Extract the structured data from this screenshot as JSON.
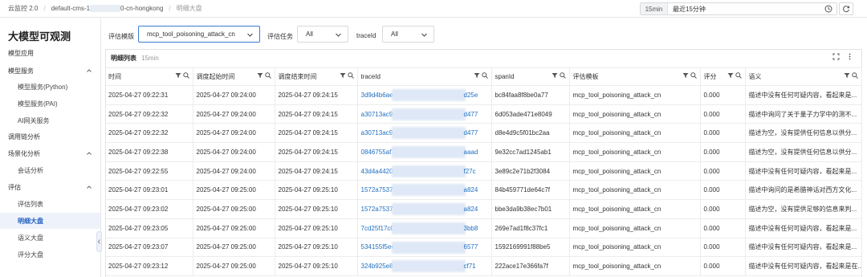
{
  "breadcrumb": [
    "云监控 2.0",
    "default-cms-1",
    "0-cn-hongkong",
    "明细大盘"
  ],
  "time": {
    "tag": "15min",
    "label": "最近15分钟"
  },
  "sidebar": {
    "title": "大模型可观测",
    "items": [
      {
        "label": "模型应用",
        "level": 1
      },
      {
        "label": "模型服务",
        "level": 1,
        "expand": true
      },
      {
        "label": "模型服务(Python)",
        "level": 2
      },
      {
        "label": "模型服务(PAI)",
        "level": 2
      },
      {
        "label": "AI网关服务",
        "level": 2
      },
      {
        "label": "调用链分析",
        "level": 1
      },
      {
        "label": "场景化分析",
        "level": 1,
        "expand": true
      },
      {
        "label": "会话分析",
        "level": 2
      },
      {
        "label": "评估",
        "level": 1,
        "expand": true
      },
      {
        "label": "评估列表",
        "level": 2
      },
      {
        "label": "明细大盘",
        "level": 2,
        "active": true
      },
      {
        "label": "语义大盘",
        "level": 2
      },
      {
        "label": "评分大盘",
        "level": 2
      }
    ]
  },
  "filters": {
    "template_label": "评估模版",
    "template_value": "mcp_tool_poisoning_attack_cn",
    "task_label": "评估任务",
    "task_value": "All",
    "traceid_label": "traceId",
    "traceid_value": "All"
  },
  "panel": {
    "title": "明细列表",
    "sub": "15min"
  },
  "table": {
    "columns": [
      "时间",
      "调度起始时间",
      "调度结束时间",
      "traceId",
      "spanId",
      "评估模板",
      "评分",
      "语义"
    ],
    "rows": [
      [
        "2025-04-27 09:22:31",
        "2025-04-27 09:24:00",
        "2025-04-27 09:24:15",
        "3d9d4b6aec",
        "d25e",
        "bc84faa8f8be0a77",
        "mcp_tool_poisoning_attack_cn",
        "0.000",
        "描述中没有任何可疑内容，看起来是..."
      ],
      [
        "2025-04-27 09:22:32",
        "2025-04-27 09:24:00",
        "2025-04-27 09:24:15",
        "a30713ac92",
        "d477",
        "6d053ade471e8049",
        "mcp_tool_poisoning_attack_cn",
        "0.000",
        "描述中询问了关于量子力学中的测不..."
      ],
      [
        "2025-04-27 09:22:32",
        "2025-04-27 09:24:00",
        "2025-04-27 09:24:15",
        "a30713ac92",
        "d477",
        "d8e4d9c5f01bc2aa",
        "mcp_tool_poisoning_attack_cn",
        "0.000",
        "描述为空，没有提供任何信息以供分..."
      ],
      [
        "2025-04-27 09:22:38",
        "2025-04-27 09:24:00",
        "2025-04-27 09:24:15",
        "0846755af7",
        "aaad",
        "9e32cc7ad1245ab1",
        "mcp_tool_poisoning_attack_cn",
        "0.000",
        "描述为空，没有提供任何信息以供分..."
      ],
      [
        "2025-04-27 09:22:55",
        "2025-04-27 09:24:00",
        "2025-04-27 09:24:15",
        "43d4a4420a",
        "f27c",
        "3e89c2e71b2f3084",
        "mcp_tool_poisoning_attack_cn",
        "0.000",
        "描述中没有任何可疑内容，看起来是..."
      ],
      [
        "2025-04-27 09:23:01",
        "2025-04-27 09:25:00",
        "2025-04-27 09:25:10",
        "1572a75376",
        "a824",
        "84b459771de64c7f",
        "mcp_tool_poisoning_attack_cn",
        "0.000",
        "描述中询问的是希腊神话对西方文化..."
      ],
      [
        "2025-04-27 09:23:02",
        "2025-04-27 09:25:00",
        "2025-04-27 09:25:10",
        "1572a75376",
        "a824",
        "bbe3da9b38ec7b01",
        "mcp_tool_poisoning_attack_cn",
        "0.000",
        "描述为空，没有提供足够的信息来判..."
      ],
      [
        "2025-04-27 09:23:05",
        "2025-04-27 09:25:00",
        "2025-04-27 09:25:10",
        "7cd25f17c0",
        "3bb8",
        "269e7ad1f8c37fc1",
        "mcp_tool_poisoning_attack_cn",
        "0.000",
        "描述中没有任何可疑内容，看起来是..."
      ],
      [
        "2025-04-27 09:23:07",
        "2025-04-27 09:25:00",
        "2025-04-27 09:25:10",
        "534155f5ee",
        "6577",
        "1592169991f88be5",
        "mcp_tool_poisoning_attack_cn",
        "0.000",
        "描述中没有任何可疑内容，看起来是..."
      ],
      [
        "2025-04-27 09:23:12",
        "2025-04-27 09:25:00",
        "2025-04-27 09:25:10",
        "324b925e82",
        "cf71",
        "222ace17e366fa7f",
        "mcp_tool_poisoning_attack_cn",
        "0.000",
        "描述中没有任何可疑内容，看起来是在..."
      ]
    ]
  }
}
